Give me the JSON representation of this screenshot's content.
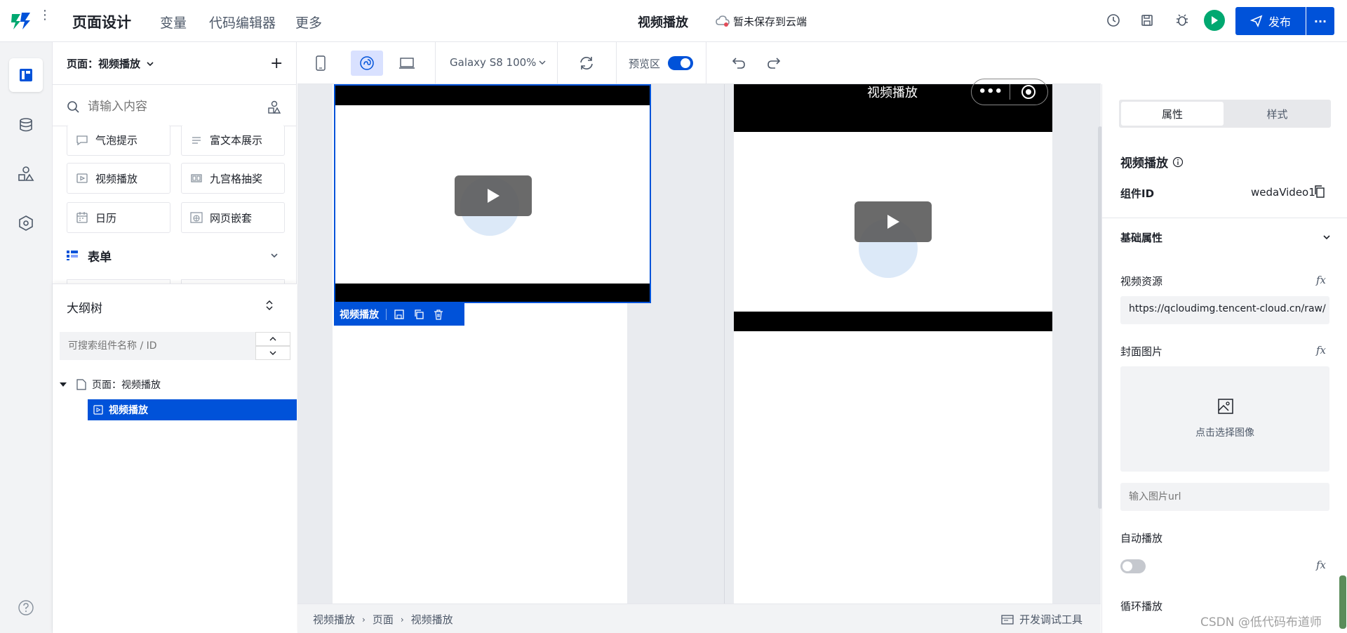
{
  "header": {
    "title": "页面设计",
    "nav": [
      "变量",
      "代码编辑器",
      "更多"
    ],
    "page_name": "视频播放",
    "save_status": "暂未保存到云端",
    "publish_label": "发布"
  },
  "left_panel": {
    "page_selector": "页面：视频播放",
    "search_placeholder": "请输入内容",
    "components": [
      {
        "label": "气泡提示",
        "icon": "comment-icon"
      },
      {
        "label": "富文本展示",
        "icon": "lines-icon"
      },
      {
        "label": "视频播放",
        "icon": "video-icon"
      },
      {
        "label": "九宫格抽奖",
        "icon": "grid-icon"
      },
      {
        "label": "日历",
        "icon": "calendar-icon"
      },
      {
        "label": "网页嵌套",
        "icon": "web-icon"
      }
    ],
    "form_section": "表单",
    "outline_title": "大纲树",
    "outline_search_placeholder": "可搜索组件名称 / ID",
    "tree_root": "页面：视频播放",
    "tree_child": "视频播放"
  },
  "toolbar": {
    "device": "Galaxy S8 100%",
    "preview_label": "预览区",
    "preview_on": true
  },
  "canvas": {
    "selection_label": "视频播放",
    "preview_title": "视频播放"
  },
  "status_bar": {
    "breadcrumb": [
      "视频播放",
      "页面",
      "视频播放"
    ],
    "devtools_label": "开发调试工具"
  },
  "right_panel": {
    "tabs": [
      "属性",
      "样式"
    ],
    "active_tab": "属性",
    "component_title": "视频播放",
    "id_label": "组件ID",
    "id_value": "wedaVideo1",
    "section_basic": "基础属性",
    "video_source_label": "视频资源",
    "video_source_value": "https://qcloudimg.tencent-cloud.cn/raw/",
    "cover_label": "封面图片",
    "cover_upload_label": "点击选择图像",
    "cover_url_placeholder": "输入图片url",
    "autoplay_label": "自动播放",
    "autoplay_on": false,
    "loop_label": "循环播放",
    "fx_label": "fx"
  },
  "watermark": "CSDN @低代码布道师",
  "colors": {
    "accent": "#0052d9",
    "run_green": "#00a870"
  }
}
